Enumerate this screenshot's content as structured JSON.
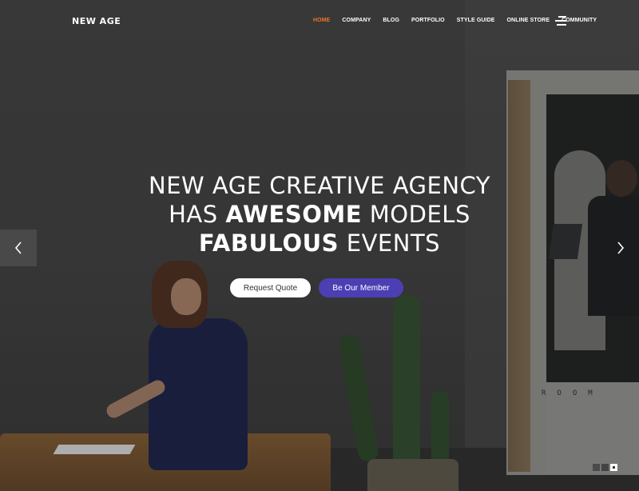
{
  "header": {
    "logo": "NEW AGE",
    "nav": [
      {
        "label": "HOME",
        "active": true
      },
      {
        "label": "COMPANY",
        "active": false
      },
      {
        "label": "BLOG",
        "active": false
      },
      {
        "label": "PORTFOLIO",
        "active": false
      },
      {
        "label": "STYLE GUIDE",
        "active": false
      },
      {
        "label": "ONLINE STORE",
        "active": false
      },
      {
        "label": "COMMUNITY",
        "active": false
      }
    ],
    "menu_icon": "hamburger-menu-icon",
    "active_color": "#e9742c"
  },
  "hero": {
    "line1": "NEW AGE CREATIVE AGENCY",
    "line2_prefix": "HAS ",
    "line2_bold": "AWESOME",
    "line2_suffix": " MODELS",
    "line3_bold": "FABULOUS",
    "line3_suffix": " EVENTS",
    "cta_primary": "Request Quote",
    "cta_secondary": "Be Our Member",
    "cta_secondary_color": "#4b3fb3",
    "room_sign": "ROOM"
  },
  "slider": {
    "prev_icon": "chevron-left-icon",
    "next_icon": "chevron-right-icon",
    "slides": 3,
    "active_slide": 3
  }
}
